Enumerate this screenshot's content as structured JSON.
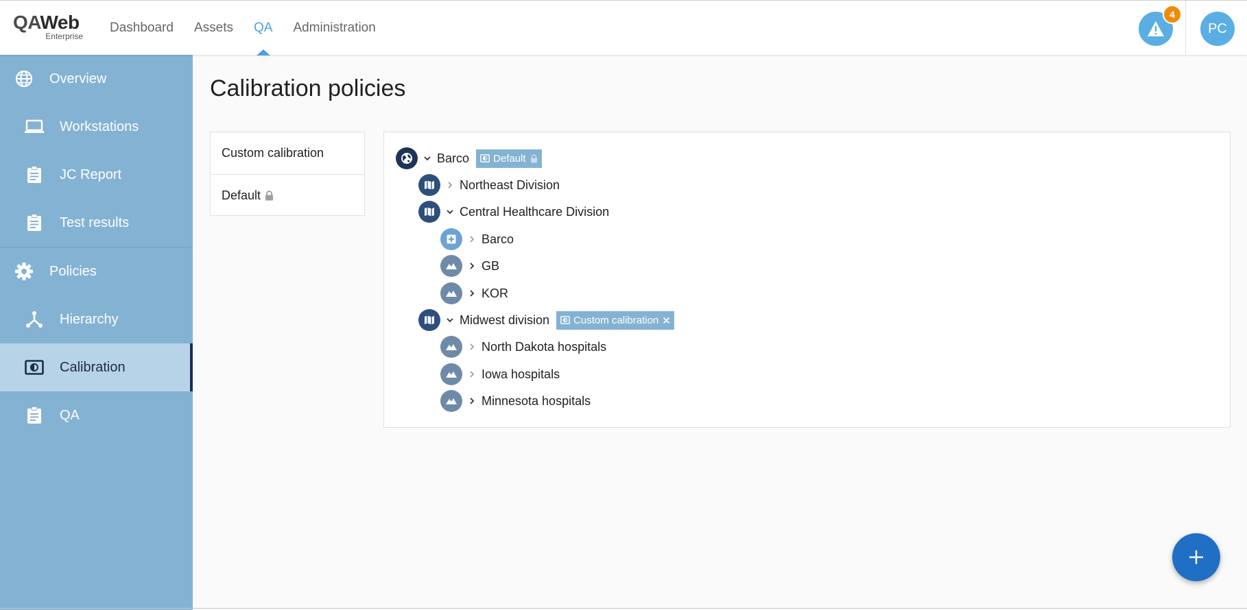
{
  "app": {
    "logo_main_a": "QA",
    "logo_main_b": "Web",
    "logo_sub": "Enterprise"
  },
  "nav": {
    "items": [
      {
        "label": "Dashboard"
      },
      {
        "label": "Assets"
      },
      {
        "label": "QA",
        "active": true
      },
      {
        "label": "Administration"
      }
    ]
  },
  "header": {
    "alert_count": "4",
    "avatar_initials": "PC"
  },
  "sidebar": {
    "items": [
      {
        "label": "Overview",
        "icon": "globe-icon"
      },
      {
        "label": "Workstations",
        "icon": "laptop-icon"
      },
      {
        "label": "JC Report",
        "icon": "clipboard-icon"
      },
      {
        "label": "Test results",
        "icon": "clipboard-icon"
      },
      {
        "label": "Policies",
        "icon": "gear-icon"
      },
      {
        "label": "Hierarchy",
        "icon": "hierarchy-icon"
      },
      {
        "label": "Calibration",
        "icon": "calibration-icon",
        "active": true
      },
      {
        "label": "QA",
        "icon": "clipboard-icon"
      }
    ]
  },
  "main": {
    "title": "Calibration policies",
    "policies": [
      {
        "label": "Custom calibration"
      },
      {
        "label": "Default",
        "locked": true
      }
    ],
    "tree": [
      {
        "label": "Barco",
        "icon": "globe-icon",
        "expanded": true,
        "tag": "Default",
        "tag_locked": true
      },
      {
        "label": "Northeast Division",
        "icon": "map-icon",
        "expanded": false
      },
      {
        "label": "Central Healthcare Division",
        "icon": "map-icon",
        "expanded": true
      },
      {
        "label": "Barco",
        "icon": "hospital-icon",
        "expanded": false
      },
      {
        "label": "GB",
        "icon": "landscape-icon",
        "expanded": false
      },
      {
        "label": "KOR",
        "icon": "landscape-icon",
        "expanded": false
      },
      {
        "label": "Midwest division",
        "icon": "map-icon",
        "expanded": true,
        "tag": "Custom calibration",
        "tag_removable": true
      },
      {
        "label": "North Dakota hospitals",
        "icon": "landscape-icon",
        "expanded": false
      },
      {
        "label": "Iowa hospitals",
        "icon": "landscape-icon",
        "expanded": false
      },
      {
        "label": "Minnesota hospitals",
        "icon": "landscape-icon",
        "expanded": false
      }
    ]
  },
  "colors": {
    "accent": "#4a9fe0",
    "sidebar": "#84b2d3",
    "badge": "#f08a0c",
    "fab": "#1f6fc5"
  }
}
